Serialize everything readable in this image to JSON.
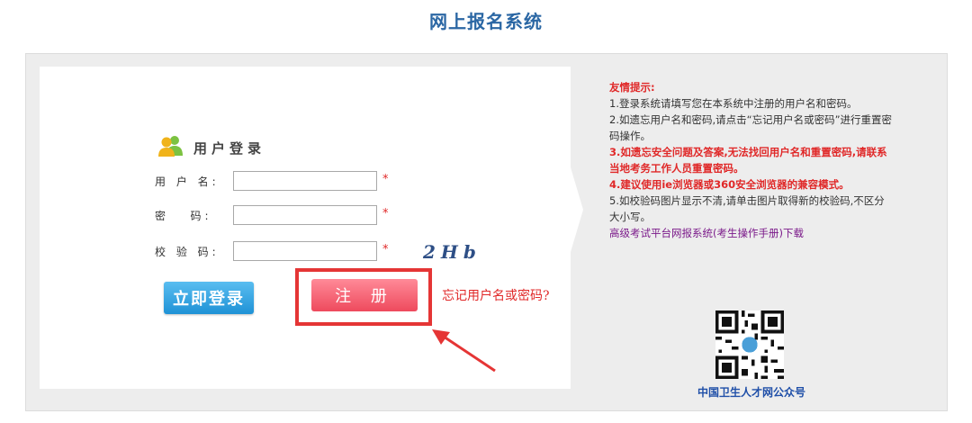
{
  "page": {
    "title": "网上报名系统"
  },
  "login": {
    "heading": "用户登录",
    "fields": {
      "username": {
        "label": "用 户 名:",
        "value": "",
        "required_mark": "*"
      },
      "password": {
        "label": "密   码:",
        "value": "",
        "required_mark": "*"
      },
      "captcha": {
        "label": "校 验 码:",
        "value": "",
        "required_mark": "*",
        "image_text": "2Hb"
      }
    },
    "login_button": "立即登录",
    "register_button": "注 册",
    "forgot_link": "忘记用户名或密码?"
  },
  "tips": {
    "heading": "友情提示:",
    "items": [
      {
        "text": "1.登录系统请填写您在本系统中注册的用户名和密码。",
        "style": "normal"
      },
      {
        "text": "2.如遗忘用户名和密码,请点击“忘记用户名或密码”进行重置密码操作。",
        "style": "normal"
      },
      {
        "text": "3.如遗忘安全问题及答案,无法找回用户名和重置密码,请联系当地考务工作人员重置密码。",
        "style": "red"
      },
      {
        "text": "4.建议使用ie浏览器或360安全浏览器的兼容模式。",
        "style": "red"
      },
      {
        "text": "5.如校验码图片显示不清,请单击图片取得新的校验码,不区分大小写。",
        "style": "normal"
      }
    ],
    "manual_link": "高级考试平台网报系统(考生操作手册)下载"
  },
  "qr": {
    "caption": "中国卫生人才网公众号"
  },
  "colors": {
    "title": "#2b67a4",
    "accent_red": "#e02828",
    "login_btn": "#1f92d6",
    "register_btn": "#ee4a5d",
    "link_purple": "#7b1a8a",
    "highlight_box": "#e53535"
  }
}
